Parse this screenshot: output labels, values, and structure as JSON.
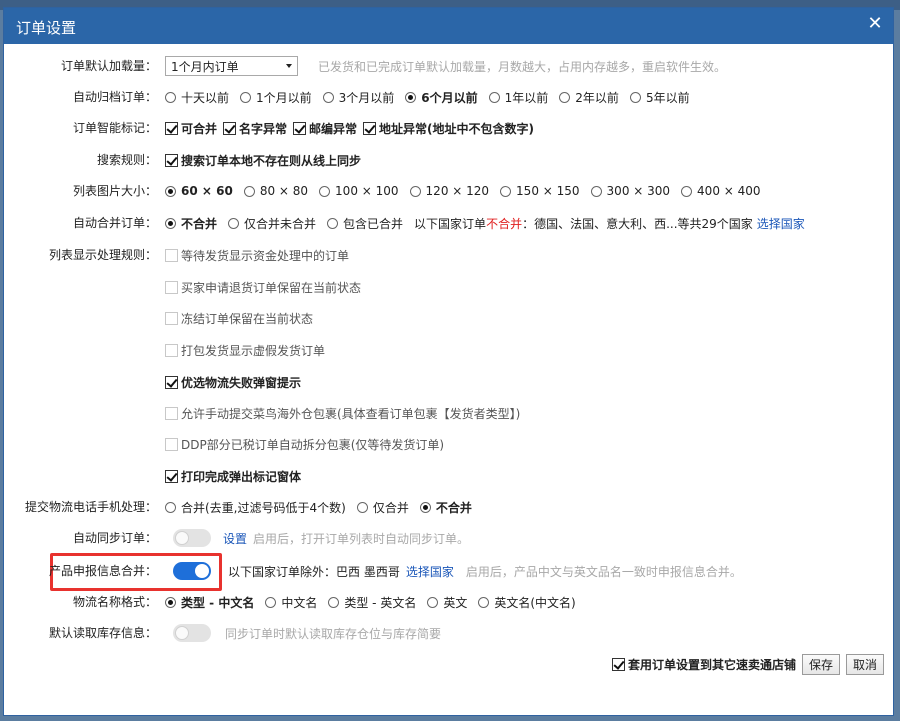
{
  "dialog": {
    "title": "订单设置",
    "close_icon": "close-icon"
  },
  "default_load": {
    "label": "订单默认加载量：",
    "selected": "1个月内订单",
    "hint": "已发货和已完成订单默认加载量，月数越大，占用内存越多，重启软件生效。"
  },
  "auto_archive": {
    "label": "自动归档订单：",
    "options": [
      "十天以前",
      "1个月以前",
      "3个月以前",
      "6个月以前",
      "1年以前",
      "2年以前",
      "5年以前"
    ],
    "selected": "6个月以前"
  },
  "smart_mark": {
    "label": "订单智能标记：",
    "options": [
      {
        "label": "可合并",
        "checked": true
      },
      {
        "label": "名字异常",
        "checked": true
      },
      {
        "label": "邮编异常",
        "checked": true
      },
      {
        "label": "地址异常(地址中不包含数字)",
        "checked": true
      }
    ]
  },
  "search_rule": {
    "label": "搜索规则：",
    "option": {
      "label": "搜索订单本地不存在则从线上同步",
      "checked": true
    }
  },
  "image_size": {
    "label": "列表图片大小：",
    "options": [
      "60 × 60",
      "80 × 80",
      "100 × 100",
      "120 × 120",
      "150 × 150",
      "300 × 300",
      "400 × 400"
    ],
    "selected": "60 × 60"
  },
  "auto_merge": {
    "label": "自动合并订单：",
    "options": [
      "不合并",
      "仅合并未合并",
      "包含已合并"
    ],
    "selected": "不合并",
    "country_prefix": "以下国家订单",
    "country_red": "不合并",
    "country_suffix": "：德国、法国、意大利、西...等共29个国家",
    "select_link": "选择国家"
  },
  "display_rules": {
    "label": "列表显示处理规则：",
    "items": [
      {
        "label": "等待发货显示资金处理中的订单",
        "checked": false
      },
      {
        "label": "买家申请退货订单保留在当前状态",
        "checked": false
      },
      {
        "label": "冻结订单保留在当前状态",
        "checked": false
      },
      {
        "label": "打包发货显示虚假发货订单",
        "checked": false
      },
      {
        "label": "优选物流失败弹窗提示",
        "checked": true
      },
      {
        "label": "允许手动提交菜鸟海外仓包裹(具体查看订单包裹【发货者类型】)",
        "checked": false
      },
      {
        "label": "DDP部分已税订单自动拆分包裹(仅等待发货订单)",
        "checked": false
      },
      {
        "label": "打印完成弹出标记窗体",
        "checked": true
      }
    ]
  },
  "phone_process": {
    "label": "提交物流电话手机处理：",
    "options": [
      "合并(去重,过滤号码低于4个数)",
      "仅合并",
      "不合并"
    ],
    "selected": "不合并"
  },
  "auto_sync": {
    "label": "自动同步订单：",
    "enabled": false,
    "settings_link": "设置",
    "hint": "启用后，打开订单列表时自动同步订单。"
  },
  "product_declare": {
    "label": "产品申报信息合并：",
    "enabled": true,
    "except_text": "以下国家订单除外：巴西  墨西哥",
    "select_link": "选择国家",
    "hint": "启用后，产品中文与英文品名一致时申报信息合并。"
  },
  "logistics_name": {
    "label": "物流名称格式：",
    "options": [
      "类型 - 中文名",
      "中文名",
      "类型 - 英文名",
      "英文",
      "英文名(中文名)"
    ],
    "selected": "类型 - 中文名"
  },
  "read_stock": {
    "label": "默认读取库存信息：",
    "enabled": false,
    "hint": "同步订单时默认读取库存仓位与库存简要"
  },
  "footer": {
    "apply_label": "套用订单设置到其它速卖通店铺",
    "apply_checked": true,
    "save_label": "保存",
    "cancel_label": "取消"
  },
  "colors": {
    "titlebar": "#2b66a8",
    "link": "#1a56b8",
    "highlight": "#e8322e",
    "toggle_on": "#1e6fd9"
  }
}
